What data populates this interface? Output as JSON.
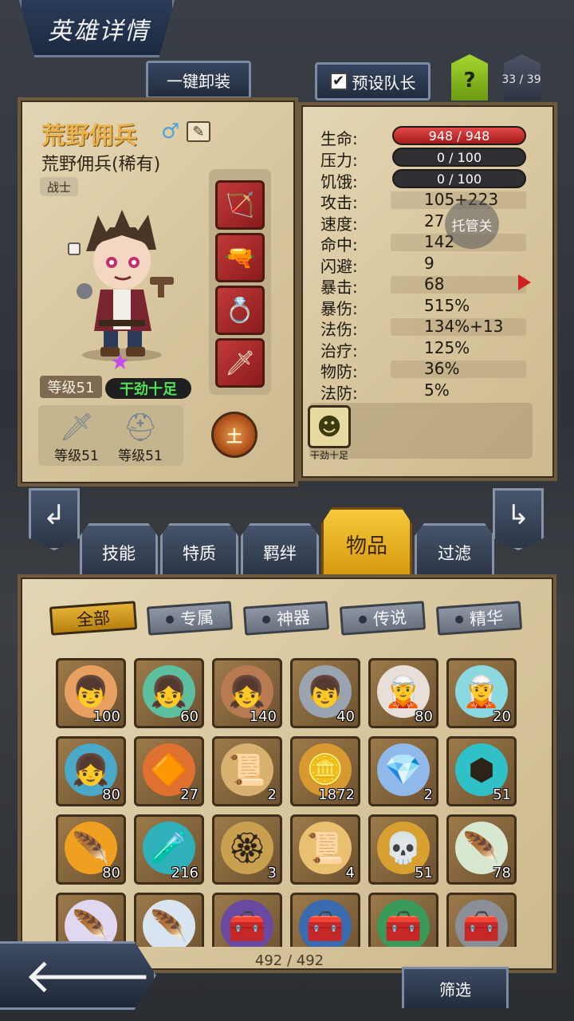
{
  "header": {
    "title": "英雄详情"
  },
  "top_buttons": {
    "unequip_all": "一键卸装",
    "preset_leader": "预设队长",
    "preset_leader_checked": "✔",
    "help": "?",
    "page_count": "33 / 39"
  },
  "hero": {
    "name": "荒野佣兵",
    "subtitle": "荒野佣兵(稀有)",
    "class": "战士",
    "gender_icon": "male-icon",
    "level": "等级51",
    "mood": "干劲十足",
    "portrait_icon": "🤠",
    "star": "★",
    "equipment": [
      {
        "name": "crossbow-icon",
        "glyph": "🏹"
      },
      {
        "name": "gun-icon",
        "glyph": "🔫"
      },
      {
        "name": "ring-icon",
        "glyph": "💍"
      },
      {
        "name": "spear-icon",
        "glyph": "🗡"
      }
    ],
    "gear": [
      {
        "name": "weapon-icon",
        "glyph": "🗡",
        "level": "等级51"
      },
      {
        "name": "helmet-icon",
        "glyph": "⛑",
        "level": "等级51"
      }
    ],
    "element": "土"
  },
  "stats": {
    "hp": {
      "label": "生命:",
      "value": "948 / 948"
    },
    "stress": {
      "label": "压力:",
      "value": "0 / 100"
    },
    "hunger": {
      "label": "饥饿:",
      "value": "0 / 100"
    },
    "rows": [
      {
        "label": "攻击:",
        "value": "105+223"
      },
      {
        "label": "速度:",
        "value": "27"
      },
      {
        "label": "命中:",
        "value": "142"
      },
      {
        "label": "闪避:",
        "value": "9"
      },
      {
        "label": "暴击:",
        "value": "68"
      },
      {
        "label": "暴伤:",
        "value": "515%"
      },
      {
        "label": "法伤:",
        "value": "134%+13"
      },
      {
        "label": "治疗:",
        "value": "125%"
      },
      {
        "label": "物防:",
        "value": "36%"
      },
      {
        "label": "法防:",
        "value": "5%"
      }
    ],
    "auto_overlay": "托管关",
    "trait_label": "干劲十足",
    "colors": {
      "hp_bar": "#d23030",
      "dark_bar": "#2e2e33"
    }
  },
  "tabs": [
    {
      "label": "技能",
      "active": false
    },
    {
      "label": "特质",
      "active": false
    },
    {
      "label": "羁绊",
      "active": false
    },
    {
      "label": "物品",
      "active": true
    },
    {
      "label": "过滤",
      "active": false
    }
  ],
  "filters": [
    {
      "label": "全部",
      "active": true
    },
    {
      "label": "专属",
      "active": false
    },
    {
      "label": "神器",
      "active": false
    },
    {
      "label": "传说",
      "active": false
    },
    {
      "label": "精华",
      "active": false
    }
  ],
  "items": [
    {
      "name": "hero-card-orange-hair",
      "glyph": "👦",
      "bg": "#e8a060",
      "count": "100"
    },
    {
      "name": "hero-card-green-hair",
      "glyph": "👧",
      "bg": "#5cc0a0",
      "count": "60"
    },
    {
      "name": "hero-card-brown-hair",
      "glyph": "👧",
      "bg": "#b87a50",
      "count": "140"
    },
    {
      "name": "hero-card-silver-hair",
      "glyph": "👦",
      "bg": "#9aa4b0",
      "count": "40"
    },
    {
      "name": "hero-card-white-hair",
      "glyph": "🧝",
      "bg": "#e8e0d8",
      "count": "80"
    },
    {
      "name": "hero-card-blue-elf",
      "glyph": "🧝",
      "bg": "#8ad8e0",
      "count": "20"
    },
    {
      "name": "hero-card-cyan-hair",
      "glyph": "👧",
      "bg": "#4aa8c8",
      "count": "80"
    },
    {
      "name": "gem-icon",
      "glyph": "🔶",
      "bg": "#e07030",
      "count": "27"
    },
    {
      "name": "scroll-icon",
      "glyph": "📜",
      "bg": "#d8b070",
      "count": "2"
    },
    {
      "name": "coin-icon",
      "glyph": "🪙",
      "bg": "#d89a30",
      "count": "1872"
    },
    {
      "name": "crystal-pile-icon",
      "glyph": "💎",
      "bg": "#90b8e8",
      "count": "2"
    },
    {
      "name": "rune-icon",
      "glyph": "⬢",
      "bg": "#30c0c8",
      "count": "51"
    },
    {
      "name": "feather-gold-icon",
      "glyph": "🪶",
      "bg": "#f0a020",
      "count": "80"
    },
    {
      "name": "potion-icon",
      "glyph": "🧪",
      "bg": "#30b0b8",
      "count": "216"
    },
    {
      "name": "medallion-icon",
      "glyph": "🏵",
      "bg": "#c8a050",
      "count": "3"
    },
    {
      "name": "card-scroll-icon",
      "glyph": "📜",
      "bg": "#e8c070",
      "count": "4"
    },
    {
      "name": "skull-hood-icon",
      "glyph": "💀",
      "bg": "#d8a030",
      "count": "51"
    },
    {
      "name": "feather-white-icon",
      "glyph": "🪶",
      "bg": "#d8e8d0",
      "count": "78"
    },
    {
      "name": "feather-purple-icon",
      "glyph": "🪶",
      "bg": "#e0d8f0",
      "count": ""
    },
    {
      "name": "feather-blue-icon",
      "glyph": "🪶",
      "bg": "#d8e4f0",
      "count": ""
    },
    {
      "name": "chest-purple-icon",
      "glyph": "🧰",
      "bg": "#6a4aa0",
      "count": ""
    },
    {
      "name": "chest-blue-icon",
      "glyph": "🧰",
      "bg": "#3a6ab0",
      "count": ""
    },
    {
      "name": "chest-green-icon",
      "glyph": "🧰",
      "bg": "#3a9a5a",
      "count": ""
    },
    {
      "name": "chest-gray-icon",
      "glyph": "🧰",
      "bg": "#8a8f98",
      "count": ""
    }
  ],
  "inventory_count": "492 / 492",
  "footer": {
    "filter_button": "筛选",
    "back_arrow": "🡐"
  }
}
